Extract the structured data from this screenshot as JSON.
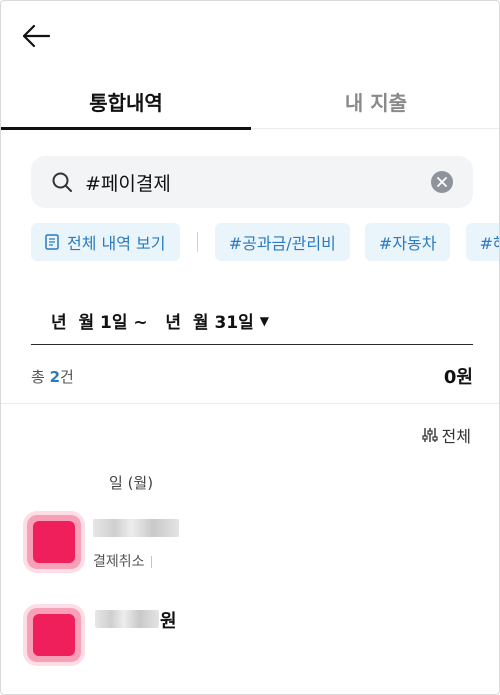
{
  "nav": {
    "back_icon": "arrow-left-icon"
  },
  "tabs": [
    {
      "label": "통합내역",
      "active": true
    },
    {
      "label": "내 지출",
      "active": false
    }
  ],
  "search": {
    "value": "#페이결제",
    "search_icon": "search-icon",
    "clear_icon": "clear-circle-icon"
  },
  "chips": {
    "view_all": {
      "label": "전체 내역 보기",
      "icon": "document-icon"
    },
    "tags": [
      "#공과금/관리비",
      "#자동차",
      "#해외결"
    ]
  },
  "period": {
    "label": "년  월 1일 ~   년  월 31일",
    "caret": "▼"
  },
  "summary": {
    "prefix": "총 ",
    "count": "2",
    "suffix": "건",
    "total": "0원"
  },
  "filter": {
    "label": "전체",
    "icon": "sliders-icon"
  },
  "list": {
    "date_header": "일 (월)",
    "items": [
      {
        "status": "결제취소"
      },
      {
        "amount_suffix": "원"
      }
    ]
  },
  "colors": {
    "accent": "#2a7bc0",
    "chip_bg": "#eaf4fb",
    "avatar": "#ee1f5b",
    "highlight": "#ffe76a"
  }
}
